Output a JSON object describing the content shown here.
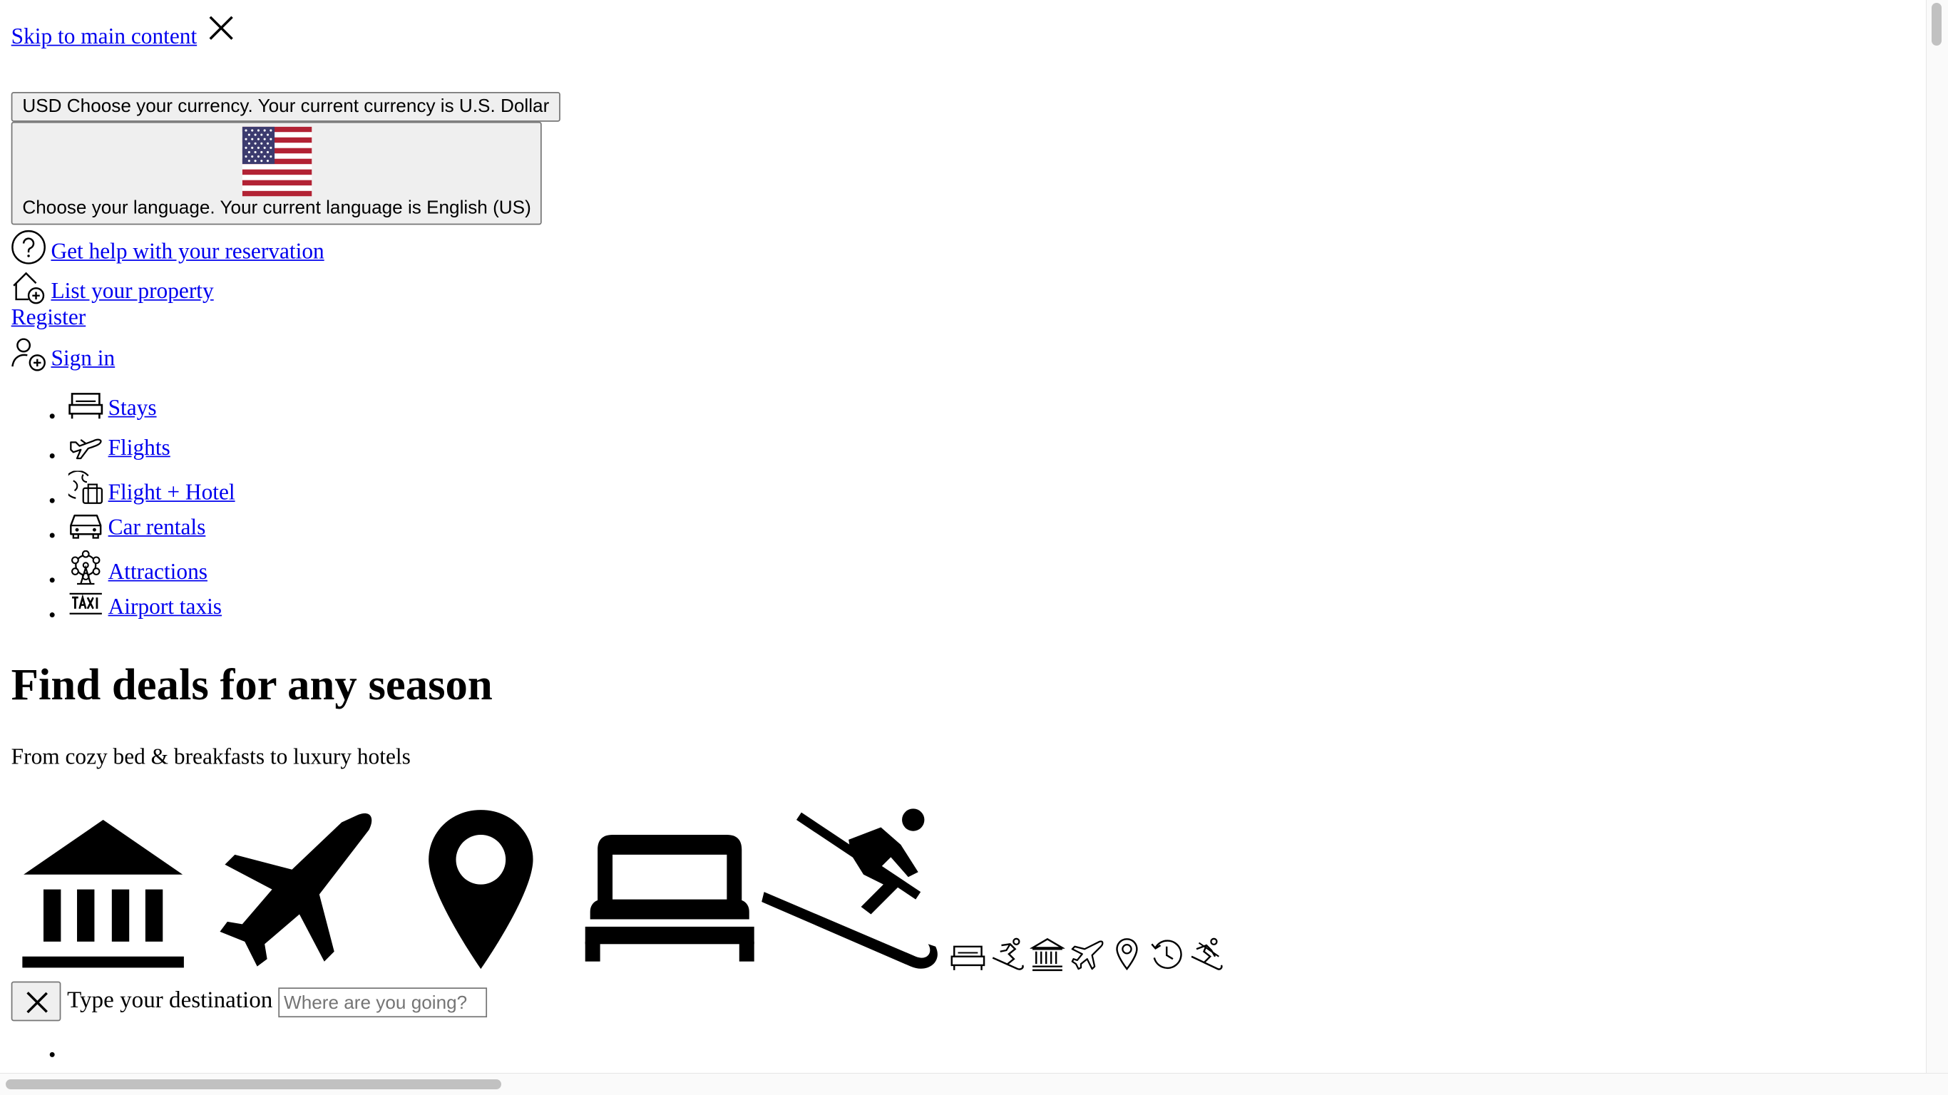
{
  "header": {
    "skip_link": "Skip to main content",
    "currency_button": "USD Choose your currency. Your current currency is U.S. Dollar",
    "language_button": "Choose your language. Your current language is English (US)",
    "help_link": "Get help with your reservation",
    "list_property_link": "List your property",
    "register_link": "Register",
    "sign_in_link": "Sign in"
  },
  "nav": {
    "items": [
      {
        "label": "Stays",
        "icon": "bed-icon"
      },
      {
        "label": "Flights",
        "icon": "plane-icon"
      },
      {
        "label": "Flight + Hotel",
        "icon": "globe-luggage-icon"
      },
      {
        "label": "Car rentals",
        "icon": "car-icon"
      },
      {
        "label": "Attractions",
        "icon": "ferris-wheel-icon"
      },
      {
        "label": "Airport taxis",
        "icon": "taxi-icon"
      }
    ]
  },
  "hero": {
    "title": "Find deals for any season",
    "subtitle": "From cozy bed & breakfasts to luxury hotels"
  },
  "icons": {
    "large": [
      "museum-icon",
      "airplane-icon",
      "map-pin-icon",
      "bed-icon",
      "skier-icon"
    ],
    "small": [
      "bed-outline-icon",
      "snowboarder-icon",
      "museum-outline-icon",
      "plane-outline-icon",
      "pin-outline-icon",
      "history-icon",
      "skier-outline-icon"
    ]
  },
  "search": {
    "destination_label": "Type your destination",
    "destination_placeholder": "Where are you going?"
  },
  "colors": {
    "link": "#0000ee",
    "button_bg": "#efefef",
    "button_border": "#767676"
  }
}
